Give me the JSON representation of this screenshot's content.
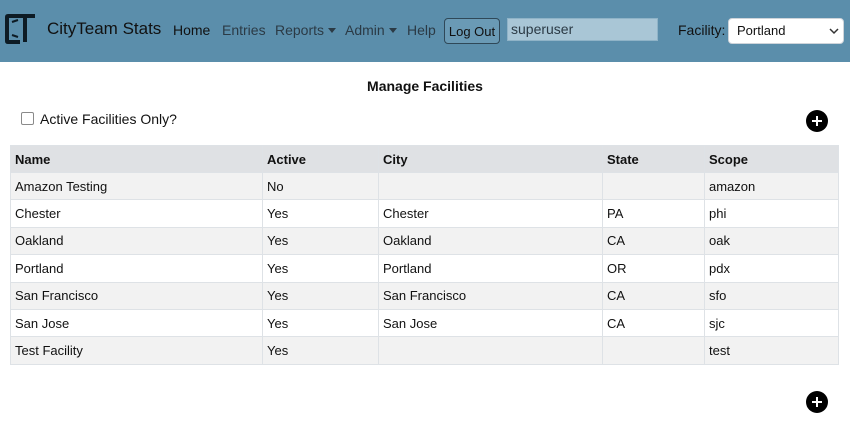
{
  "navbar": {
    "brand": "CityTeam Stats",
    "links": [
      {
        "label": "Home"
      },
      {
        "label": "Entries"
      },
      {
        "label": "Reports"
      },
      {
        "label": "Admin"
      },
      {
        "label": "Help"
      }
    ],
    "logout_label": "Log Out",
    "username": "superuser",
    "facility_label": "Facility:",
    "facility_selected": "Portland"
  },
  "page": {
    "title": "Manage Facilities",
    "filter_label": "Active Facilities Only?",
    "filter_checked": false
  },
  "table": {
    "headers": [
      "Name",
      "Active",
      "City",
      "State",
      "Scope"
    ],
    "rows": [
      [
        "Amazon Testing",
        "No",
        "",
        "",
        "amazon"
      ],
      [
        "Chester",
        "Yes",
        "Chester",
        "PA",
        "phi"
      ],
      [
        "Oakland",
        "Yes",
        "Oakland",
        "CA",
        "oak"
      ],
      [
        "Portland",
        "Yes",
        "Portland",
        "OR",
        "pdx"
      ],
      [
        "San Francisco",
        "Yes",
        "San Francisco",
        "CA",
        "sfo"
      ],
      [
        "San Jose",
        "Yes",
        "San Jose",
        "CA",
        "sjc"
      ],
      [
        "Test Facility",
        "Yes",
        "",
        "",
        "test"
      ]
    ]
  },
  "icons": {
    "logo": "cityteam-logo",
    "add": "plus-circle-icon",
    "dropdown": "chevron-down-icon"
  },
  "colors": {
    "navbar": "#5b8eab",
    "header_row": "#dfe1e4",
    "stripe": "#f2f2f2"
  }
}
